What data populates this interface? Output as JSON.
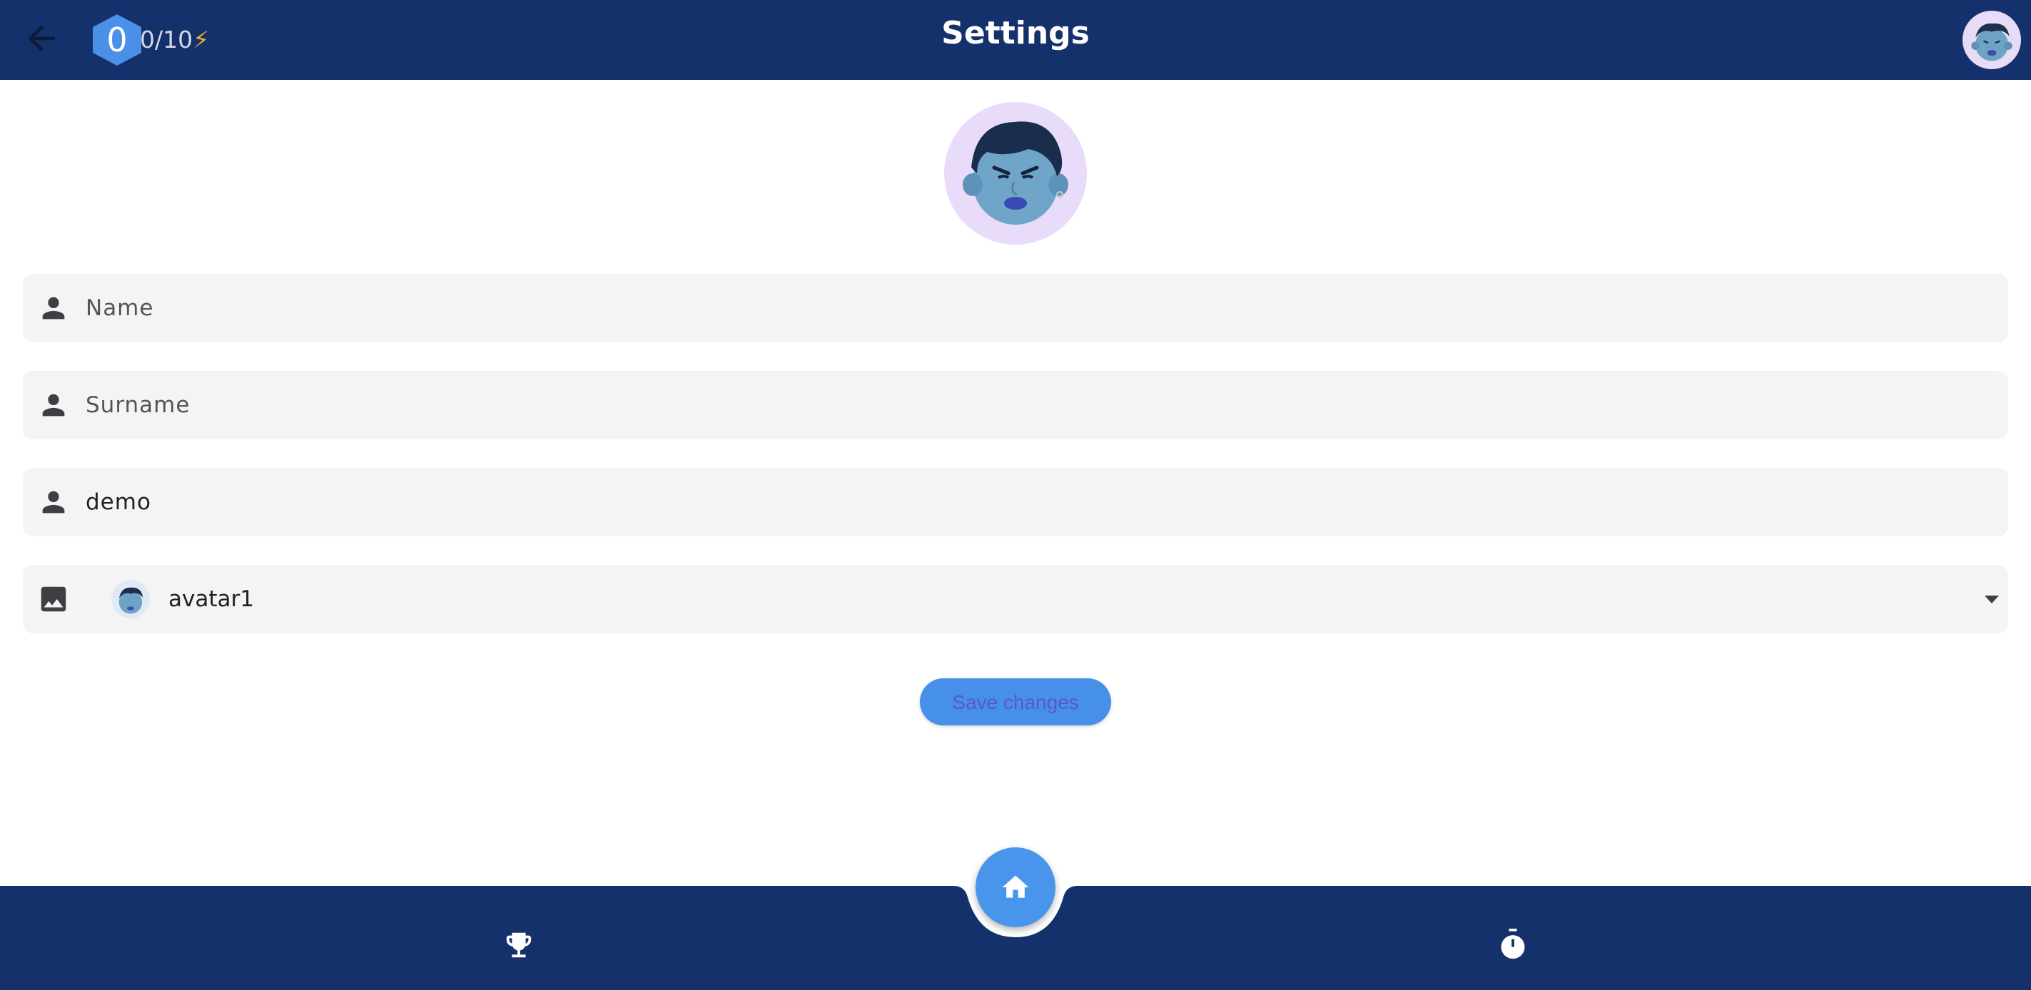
{
  "header": {
    "title": "Settings",
    "level": "0",
    "energy": "0/10",
    "energy_icon": "⚡"
  },
  "form": {
    "name_placeholder": "Name",
    "name_value": "",
    "surname_placeholder": "Surname",
    "surname_value": "",
    "username_value": "demo",
    "avatar_selected": "avatar1"
  },
  "actions": {
    "save_label": "Save changes"
  },
  "icons": {
    "back": "arrow-left",
    "level": "hexagon-badge",
    "field_person": "person",
    "field_image": "image",
    "dropdown": "caret-down",
    "home": "home",
    "leaderboard": "trophy",
    "timer": "stopwatch"
  },
  "colors": {
    "primary_dark": "#15316b",
    "accent_blue": "#4790ea",
    "field_bg": "#f4f4f4",
    "avatar_bg": "#e8dcfa"
  }
}
